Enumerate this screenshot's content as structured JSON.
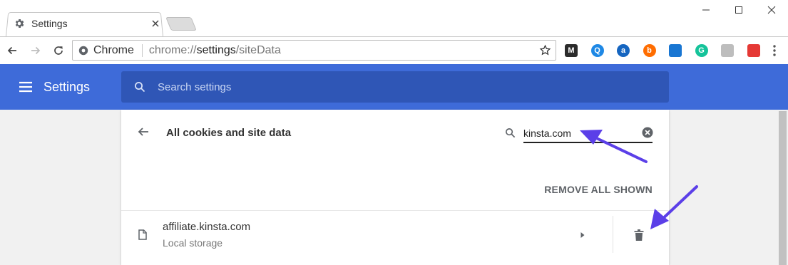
{
  "tab": {
    "title": "Settings",
    "favicon": "gear-icon"
  },
  "window_controls": [
    "minimize-icon",
    "maximize-icon",
    "close-icon"
  ],
  "omnibox": {
    "chip_label": "Chrome",
    "url_scheme": "chrome://",
    "url_host": "settings",
    "url_path": "/siteData"
  },
  "extensions": [
    {
      "name": "m-ext-icon",
      "label": "M",
      "color": "#2b2b2b"
    },
    {
      "name": "q-ext-icon",
      "label": "Q",
      "color": "#1e88e5"
    },
    {
      "name": "a-ext-icon",
      "label": "a",
      "color": "#1565c0"
    },
    {
      "name": "b-ext-icon",
      "label": "b",
      "color": "#ff6d00"
    },
    {
      "name": "calendar-ext-icon",
      "label": "",
      "color": "#1976d2"
    },
    {
      "name": "grammarly-ext-icon",
      "label": "G",
      "color": "#15c39a"
    },
    {
      "name": "clipboard-ext-icon",
      "label": "",
      "color": "#bdbdbd"
    },
    {
      "name": "todoist-ext-icon",
      "label": "",
      "color": "#e53935"
    }
  ],
  "header": {
    "title": "Settings",
    "search_placeholder": "Search settings",
    "color": "#3e6bd9"
  },
  "card": {
    "title": "All cookies and site data",
    "filter_value": "kinsta.com",
    "remove_all_label": "REMOVE ALL SHOWN",
    "rows": [
      {
        "site": "affiliate.kinsta.com",
        "detail": "Local storage"
      }
    ]
  },
  "annotation_color": "#5b3fe8"
}
